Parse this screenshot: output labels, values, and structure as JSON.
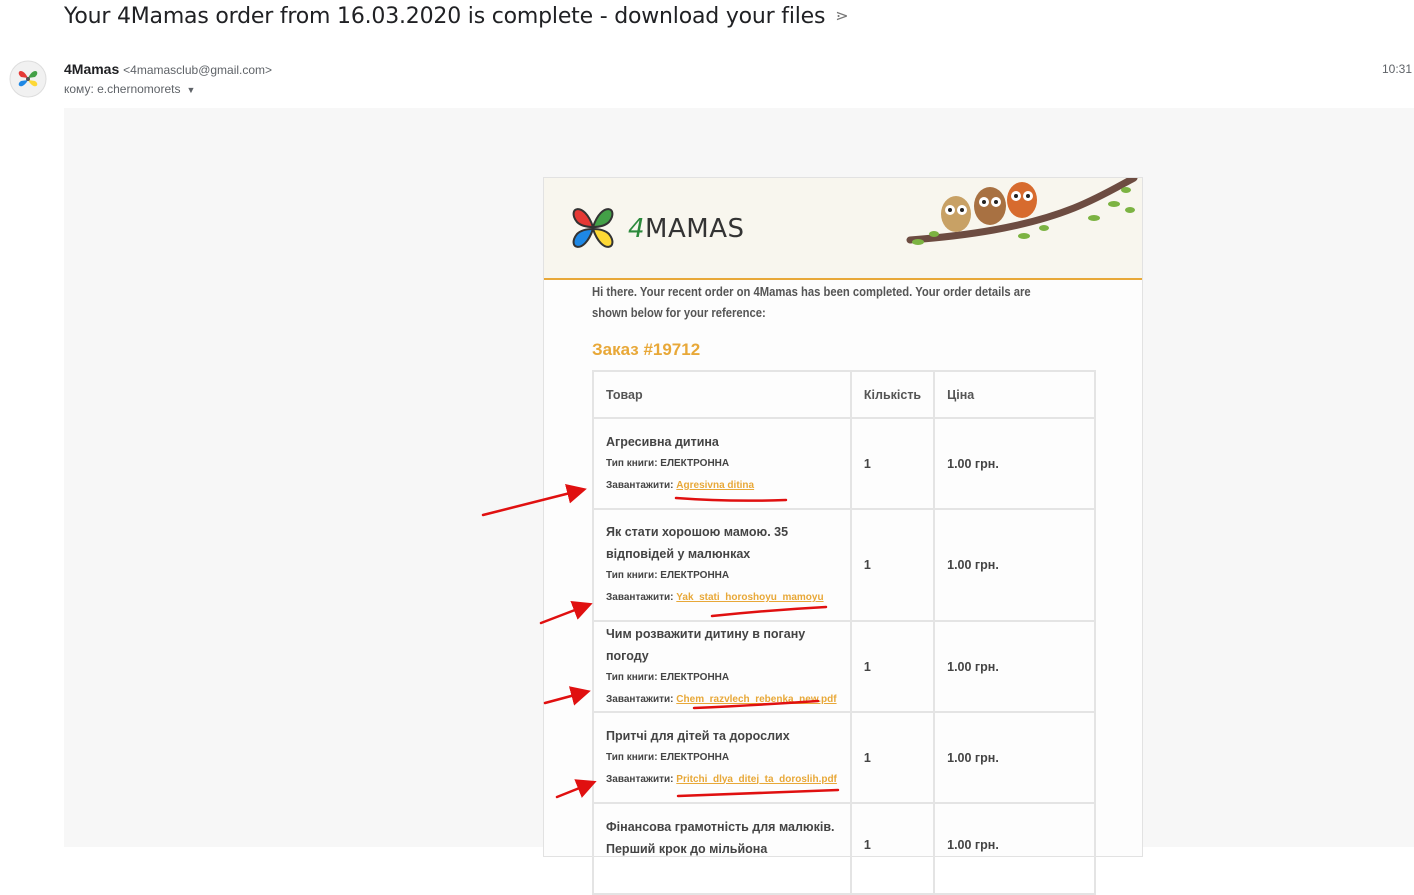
{
  "email": {
    "subject": "Your 4Mamas order from 16.03.2020 is complete - download your files",
    "sender_name": "4Mamas",
    "sender_email": "<4mamasclub@gmail.com>",
    "recipient": "кому: e.chernomorets",
    "time": "10:31"
  },
  "header": {
    "logo_four": "4",
    "logo_rest": "MAMAS"
  },
  "body": {
    "greeting": "Hi there. Your recent order on 4Mamas has been completed. Your order details are shown below for your reference:",
    "order_title": "Заказ #19712"
  },
  "table": {
    "columns": [
      "Товар",
      "Кількість",
      "Ціна"
    ],
    "type_label": "Тип книги: ЕЛЕКТРОННА",
    "download_label": "Завантажити: ",
    "rows": [
      {
        "name": "Агресивна дитина",
        "link": "Agresivna ditina",
        "qty": "1",
        "price": "1.00 грн."
      },
      {
        "name": "Як стати хорошою мамою. 35 відповідей у малюнках",
        "link": "Yak_stati_horoshoyu_mamoyu",
        "qty": "1",
        "price": "1.00 грн."
      },
      {
        "name": "Чим розважити дитину в погану погоду",
        "link": "Chem_razvlech_rebenka_new.pdf",
        "qty": "1",
        "price": "1.00 грн."
      },
      {
        "name": "Притчі для дітей та дорослих",
        "link": "Pritchi_dlya_ditej_ta_doroslih.pdf",
        "qty": "1",
        "price": "1.00 грн."
      },
      {
        "name": "Фінансова грамотність для малюків. Перший крок до мільйона",
        "qty": "1",
        "price": "1.00 грн."
      }
    ]
  },
  "colors": {
    "accent": "#e8a838",
    "annotation": "#e01010"
  }
}
